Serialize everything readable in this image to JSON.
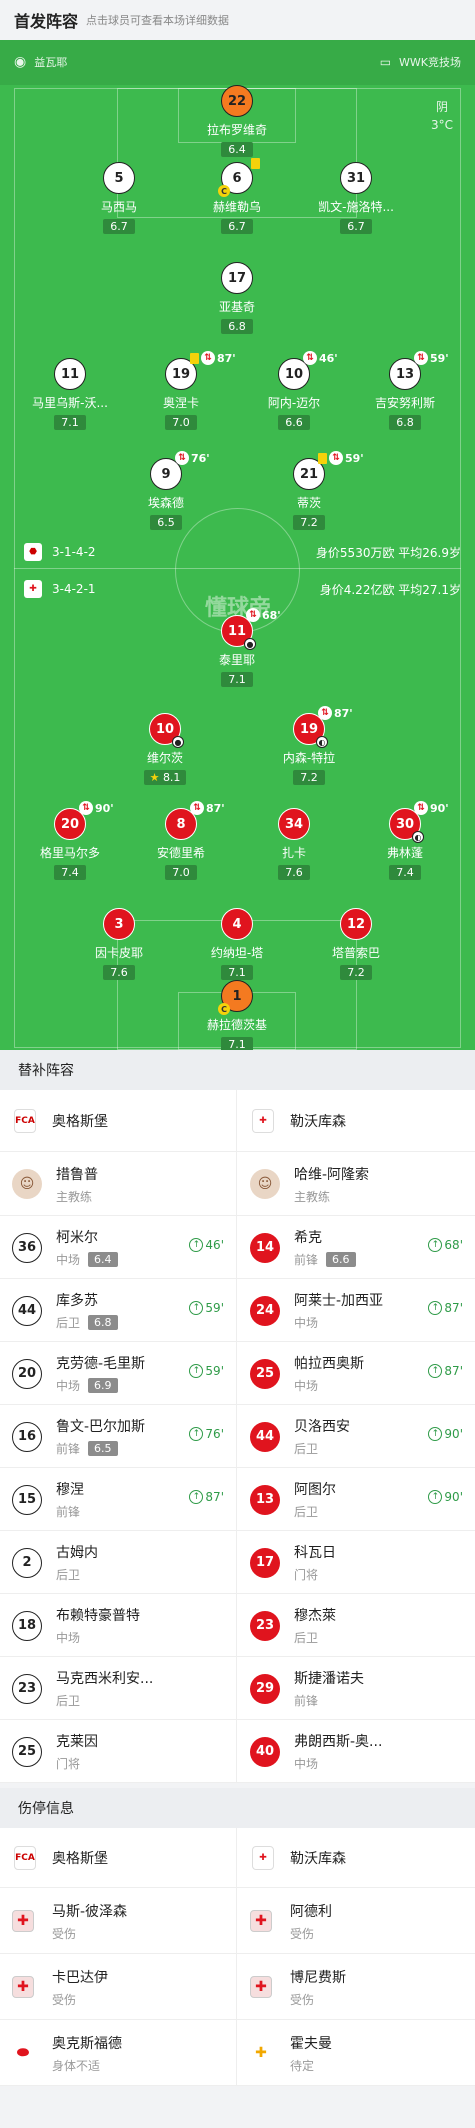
{
  "header": {
    "title": "首发阵容",
    "subtitle": "点击球员可查看本场详细数据"
  },
  "pitch": {
    "left_provider": "益瓦耶",
    "right_provider": "WWK竞技场",
    "weather": "阴",
    "temp": "3°C",
    "watermark": "懂球帝",
    "home_formation": "3-1-4-2",
    "home_value": "身价5530万欧 平均26.9岁",
    "away_formation": "3-4-2-1",
    "away_value": "身价4.22亿欧 平均27.1岁"
  },
  "home_players": [
    {
      "num": "22",
      "name": "拉布罗维奇",
      "rating": "6.4"
    },
    {
      "num": "5",
      "name": "马西马",
      "rating": "6.7"
    },
    {
      "num": "6",
      "name": "赫维勒乌",
      "rating": "6.7"
    },
    {
      "num": "31",
      "name": "凯文-施洛特...",
      "rating": "6.7"
    },
    {
      "num": "17",
      "name": "亚基奇",
      "rating": "6.8"
    },
    {
      "num": "11",
      "name": "马里乌斯-沃...",
      "rating": "7.1"
    },
    {
      "num": "19",
      "name": "奥涅卡",
      "rating": "7.0",
      "sub": "87'"
    },
    {
      "num": "10",
      "name": "阿内-迈尔",
      "rating": "6.6",
      "sub": "46'"
    },
    {
      "num": "13",
      "name": "吉安努利斯",
      "rating": "6.8",
      "sub": "59'"
    },
    {
      "num": "9",
      "name": "埃森德",
      "rating": "6.5",
      "sub": "76'"
    },
    {
      "num": "21",
      "name": "蒂茨",
      "rating": "7.2",
      "sub": "59'"
    }
  ],
  "away_players": [
    {
      "num": "11",
      "name": "泰里耶",
      "rating": "7.1",
      "sub": "68'"
    },
    {
      "num": "10",
      "name": "维尔茨",
      "rating": "8.1"
    },
    {
      "num": "19",
      "name": "内森-特拉",
      "rating": "7.2",
      "sub": "87'"
    },
    {
      "num": "20",
      "name": "格里马尔多",
      "rating": "7.4",
      "sub": "90'"
    },
    {
      "num": "8",
      "name": "安德里希",
      "rating": "7.0",
      "sub": "87'"
    },
    {
      "num": "34",
      "name": "扎卡",
      "rating": "7.6"
    },
    {
      "num": "30",
      "name": "弗林蓬",
      "rating": "7.4",
      "sub": "90'"
    },
    {
      "num": "3",
      "name": "因卡皮耶",
      "rating": "7.6"
    },
    {
      "num": "4",
      "name": "约纳坦-塔",
      "rating": "7.1"
    },
    {
      "num": "12",
      "name": "塔普索巴",
      "rating": "7.2"
    },
    {
      "num": "1",
      "name": "赫拉德茨基",
      "rating": "7.1"
    }
  ],
  "subs_section": {
    "title": "替补阵容"
  },
  "teams": {
    "home": "奥格斯堡",
    "away": "勒沃库森"
  },
  "coaches": {
    "home": {
      "name": "措鲁普",
      "role": "主教练"
    },
    "away": {
      "name": "哈维-阿隆索",
      "role": "主教练"
    }
  },
  "subs_home": [
    {
      "num": "36",
      "name": "柯米尔",
      "pos": "中场",
      "score": "6.4",
      "min": "46'"
    },
    {
      "num": "44",
      "name": "库多苏",
      "pos": "后卫",
      "score": "6.8",
      "min": "59'"
    },
    {
      "num": "20",
      "name": "克劳德-毛里斯",
      "pos": "中场",
      "score": "6.9",
      "min": "59'"
    },
    {
      "num": "16",
      "name": "鲁文-巴尔加斯",
      "pos": "前锋",
      "score": "6.5",
      "min": "76'"
    },
    {
      "num": "15",
      "name": "穆涅",
      "pos": "前锋",
      "score": "",
      "min": "87'"
    },
    {
      "num": "2",
      "name": "古姆内",
      "pos": "后卫",
      "score": "",
      "min": ""
    },
    {
      "num": "18",
      "name": "布赖特豪普特",
      "pos": "中场",
      "score": "",
      "min": ""
    },
    {
      "num": "23",
      "name": "马克西米利安...",
      "pos": "后卫",
      "score": "",
      "min": ""
    },
    {
      "num": "25",
      "name": "克莱因",
      "pos": "门将",
      "score": "",
      "min": ""
    }
  ],
  "subs_away": [
    {
      "num": "14",
      "name": "希克",
      "pos": "前锋",
      "score": "6.6",
      "min": "68'"
    },
    {
      "num": "24",
      "name": "阿莱士-加西亚",
      "pos": "中场",
      "score": "",
      "min": "87'"
    },
    {
      "num": "25",
      "name": "帕拉西奥斯",
      "pos": "中场",
      "score": "",
      "min": "87'"
    },
    {
      "num": "44",
      "name": "贝洛西安",
      "pos": "后卫",
      "score": "",
      "min": "90'"
    },
    {
      "num": "13",
      "name": "阿图尔",
      "pos": "后卫",
      "score": "",
      "min": "90'"
    },
    {
      "num": "17",
      "name": "科瓦日",
      "pos": "门将",
      "score": "",
      "min": ""
    },
    {
      "num": "23",
      "name": "穆杰萊",
      "pos": "后卫",
      "score": "",
      "min": ""
    },
    {
      "num": "29",
      "name": "斯捷潘诺夫",
      "pos": "前锋",
      "score": "",
      "min": ""
    },
    {
      "num": "40",
      "name": "弗朗西斯-奥...",
      "pos": "中场",
      "score": "",
      "min": ""
    }
  ],
  "injury_section": {
    "title": "伤停信息"
  },
  "injuries_home": [
    {
      "name": "马斯-彼泽森",
      "status": "受伤",
      "icon": "medical-cross-icon"
    },
    {
      "name": "卡巴达伊",
      "status": "受伤",
      "icon": "medical-cross-icon"
    },
    {
      "name": "奥克斯福德",
      "status": "身体不适",
      "icon": "pill-icon"
    }
  ],
  "injuries_away": [
    {
      "name": "阿德利",
      "status": "受伤",
      "icon": "medical-cross-icon"
    },
    {
      "name": "博尼费斯",
      "status": "受伤",
      "icon": "medical-cross-icon"
    },
    {
      "name": "霍夫曼",
      "status": "待定",
      "icon": "pending-cross-icon"
    }
  ],
  "colors": {
    "pitch": "#3dba4e",
    "home": "#ffffff",
    "away": "#e0141e",
    "accent": "#2f9b48"
  }
}
